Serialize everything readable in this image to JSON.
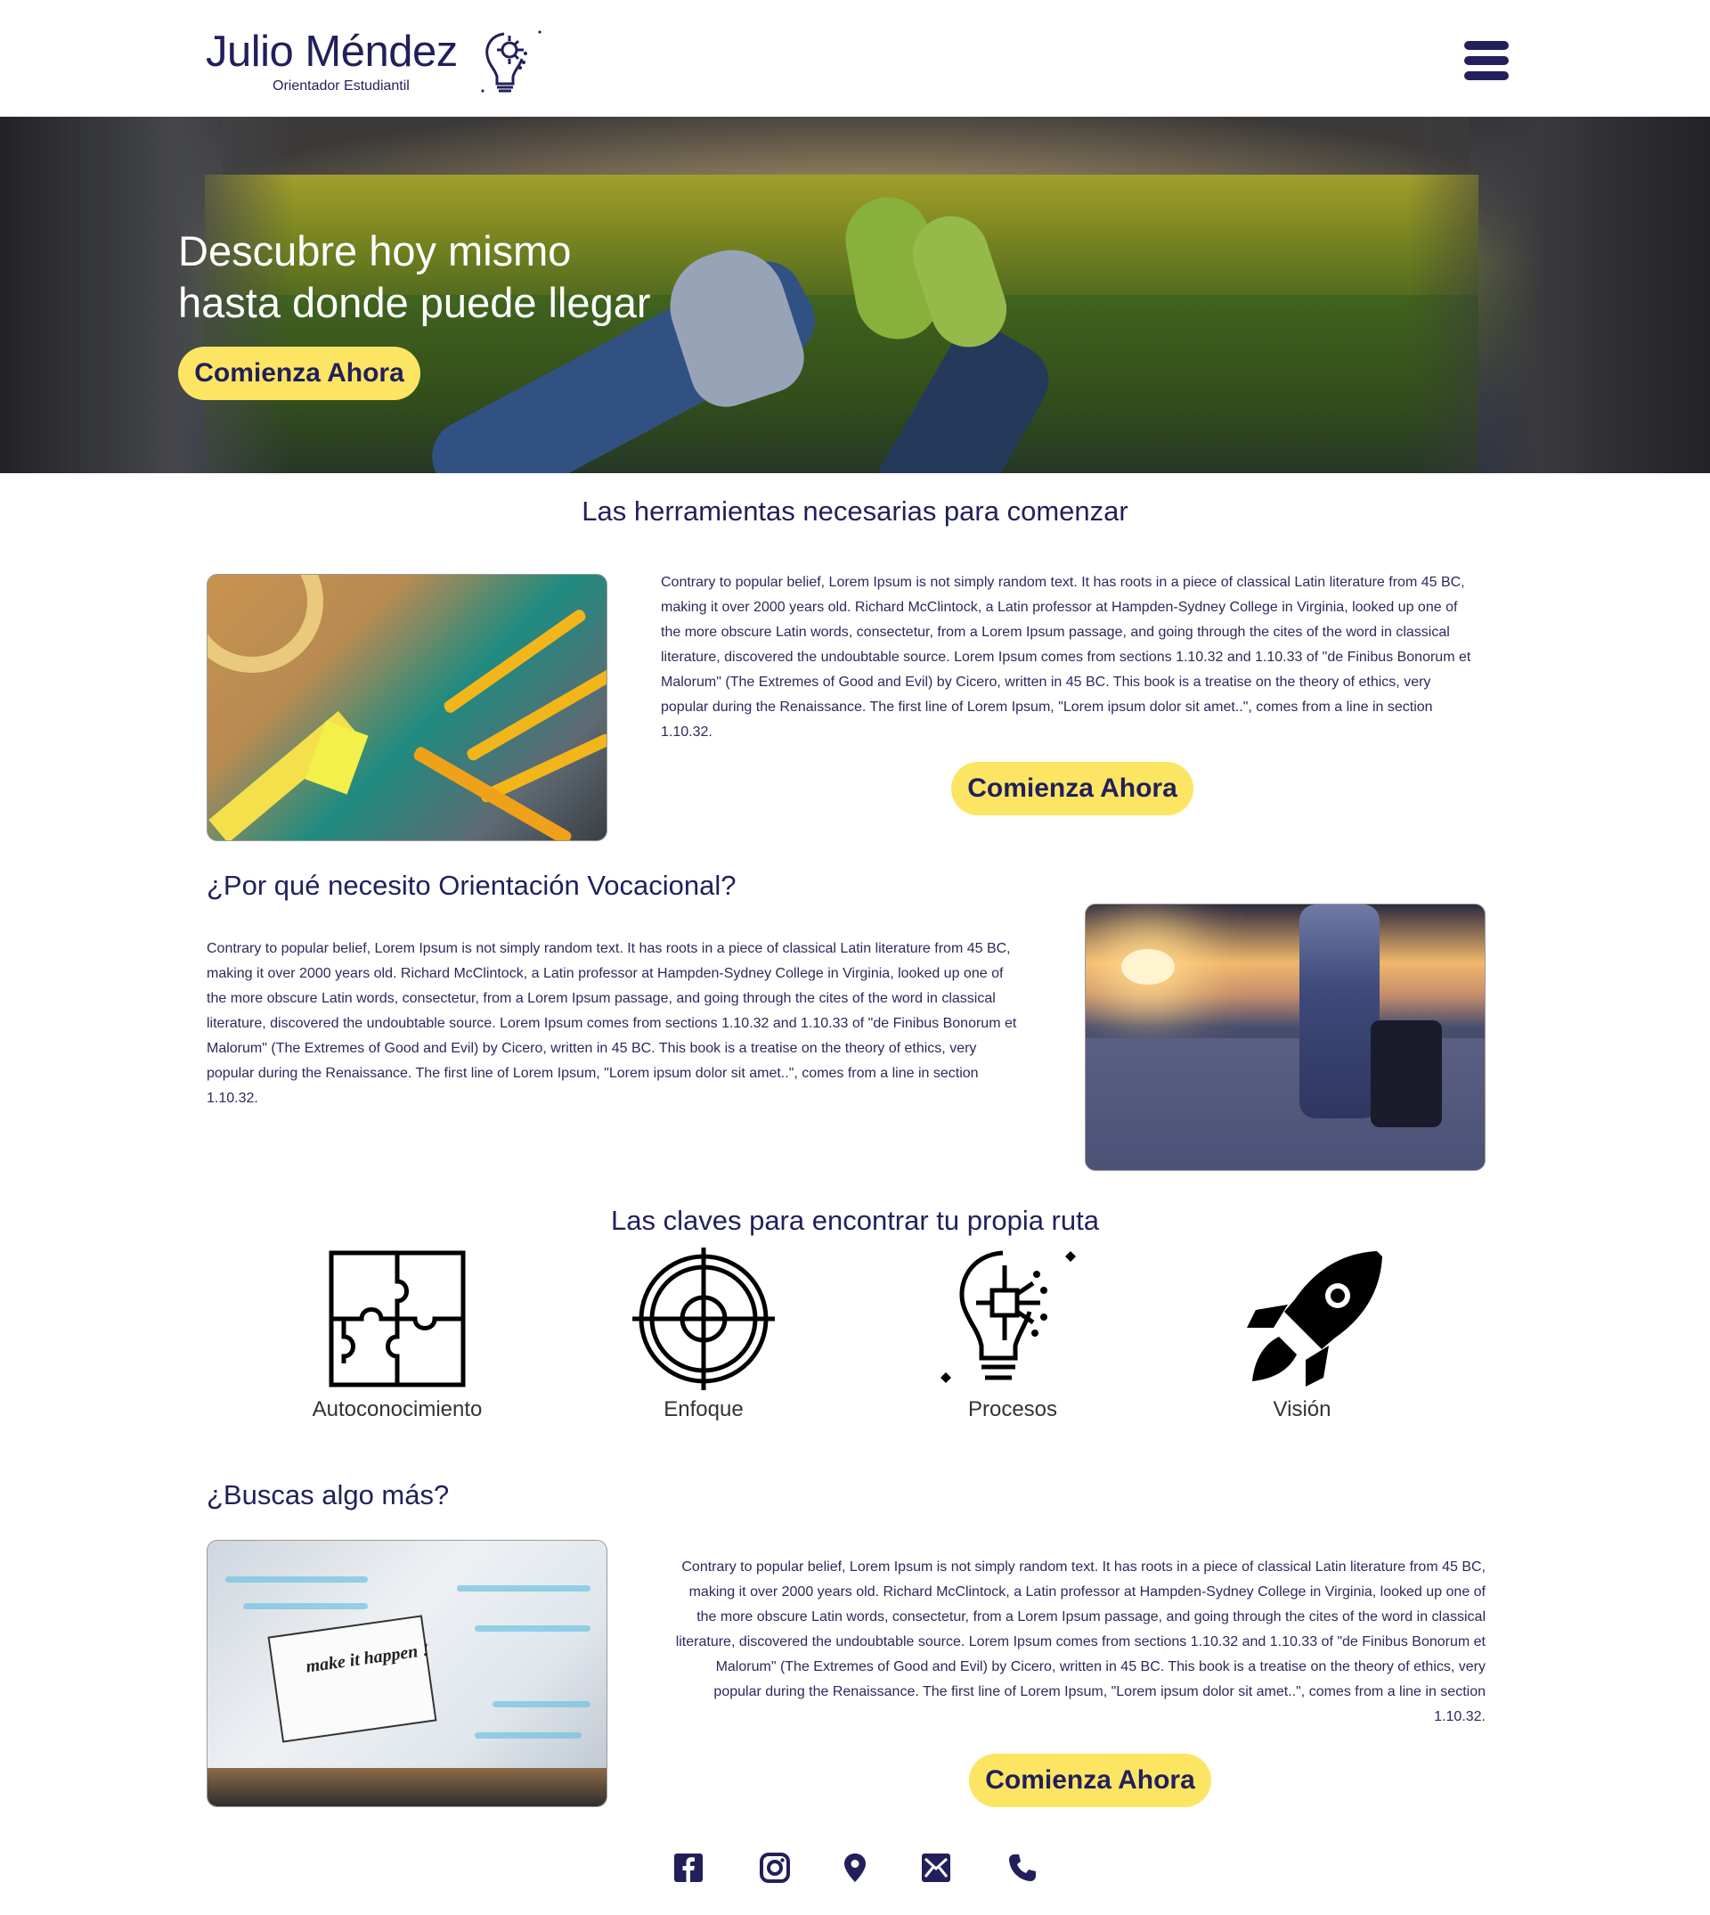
{
  "header": {
    "brand_name": "Julio Méndez",
    "brand_sub": "Orientador Estudiantil",
    "logo_icon": "lightbulb-gear-icon",
    "menu_icon": "hamburger-menu-icon"
  },
  "hero": {
    "title_line1": "Descubre hoy mismo",
    "title_line2": "hasta donde puede llegar",
    "cta": "Comienza Ahora"
  },
  "section_tools": {
    "title": "Las herramientas necesarias para comenzar",
    "paragraph": "Contrary to popular belief, Lorem Ipsum is not simply random text. It has roots in a piece of classical Latin literature from 45 BC, making it over 2000 years old. Richard McClintock, a Latin professor at Hampden-Sydney College in Virginia, looked up one of the more obscure Latin words, consectetur, from a Lorem Ipsum passage, and going through the cites of the word in classical literature, discovered the undoubtable source. Lorem Ipsum comes from sections 1.10.32 and 1.10.33 of \"de Finibus Bonorum et Malorum\" (The Extremes of Good and Evil) by Cicero, written in 45 BC. This book is a treatise on the theory of ethics, very popular during the Renaissance. The first line of Lorem Ipsum, \"Lorem ipsum dolor sit amet..\", comes from a line in section 1.10.32.",
    "cta": "Comienza Ahora"
  },
  "section_why": {
    "title": "¿Por qué necesito Orientación Vocacional?",
    "paragraph": "Contrary to popular belief, Lorem Ipsum is not simply random text. It has roots in a piece of classical Latin literature from 45 BC, making it over 2000 years old. Richard McClintock, a Latin professor at Hampden-Sydney College in Virginia, looked up one of the more obscure Latin words, consectetur, from a Lorem Ipsum passage, and going through the cites of the word in classical literature, discovered the undoubtable source. Lorem Ipsum comes from sections 1.10.32 and 1.10.33 of \"de Finibus Bonorum et Malorum\" (The Extremes of Good and Evil) by Cicero, written in 45 BC. This book is a treatise on the theory of ethics, very popular during the Renaissance. The first line of Lorem Ipsum, \"Lorem ipsum dolor sit amet..\", comes from a line in section 1.10.32."
  },
  "section_keys": {
    "title": "Las claves para encontrar tu propia ruta",
    "items": [
      {
        "label": "Autoconocimiento",
        "icon": "puzzle-icon"
      },
      {
        "label": "Enfoque",
        "icon": "target-icon"
      },
      {
        "label": "Procesos",
        "icon": "lightbulb-circuit-icon"
      },
      {
        "label": "Visión",
        "icon": "rocket-icon"
      }
    ]
  },
  "section_more": {
    "title": "¿Buscas algo más?",
    "paragraph": "Contrary to popular belief, Lorem Ipsum is not simply random text. It has roots in a piece of classical Latin literature from 45 BC, making it over 2000 years old. Richard McClintock, a Latin professor at Hampden-Sydney College in Virginia, looked up one of the more obscure Latin words, consectetur, from a Lorem Ipsum passage, and going through the cites of the word in classical literature, discovered the undoubtable source. Lorem Ipsum comes from sections 1.10.32 and 1.10.33 of \"de Finibus Bonorum et Malorum\" (The Extremes of Good and Evil) by Cicero, written in 45 BC. This book is a treatise on the theory of ethics, very popular during the Renaissance. The first line of Lorem Ipsum, \"Lorem ipsum dolor sit amet..\", comes from a line in section 1.10.32.",
    "cta": "Comienza Ahora",
    "image_text": "make it happen !"
  },
  "footer": {
    "social_icons": [
      "facebook-icon",
      "instagram-icon",
      "location-pin-icon",
      "email-icon",
      "phone-icon"
    ]
  },
  "colors": {
    "navy": "#221f5b",
    "accent_yellow": "#fce562",
    "text": "#2b2a5c"
  }
}
